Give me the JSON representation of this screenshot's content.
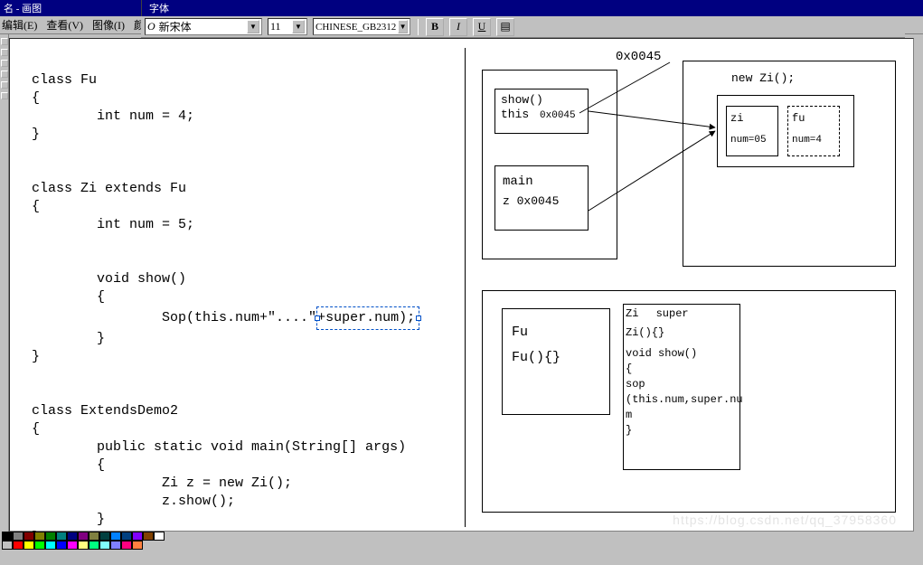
{
  "window": {
    "title_left": "名 - 画图",
    "title_sub": "字体"
  },
  "menu": {
    "edit": "编辑(E)",
    "view": "查看(V)",
    "image": "图像(I)",
    "color": "颜色("
  },
  "toolbar": {
    "font_prefix": "O",
    "font_name": "新宋体",
    "font_size": "11",
    "charset": "CHINESE_GB2312",
    "bold": "B",
    "italic": "I",
    "underline": "U"
  },
  "code": {
    "l1": "class Fu",
    "l2": "{",
    "l3": "        int num = 4;",
    "l4": "}",
    "l5": "",
    "l6": "",
    "l7": "class Zi extends Fu",
    "l8": "{",
    "l9": "        int num = 5;",
    "l10": "",
    "l11": "",
    "l12": "        void show()",
    "l13": "        {",
    "l14a": "                Sop(this.num+\"....\"",
    "sel": "+super.num);",
    "l15": "        }",
    "l16": "}",
    "l17": "",
    "l18": "",
    "l19": "class ExtendsDemo2",
    "l20": "{",
    "l21": "        public static void main(String[] args)",
    "l22": "        {",
    "l23": "                Zi z = new Zi();",
    "l24": "                z.show();",
    "l25": "        }",
    "l26": "}"
  },
  "diagram": {
    "addr": "0x0045",
    "stack_show_l1": "show()",
    "stack_show_l2": "this",
    "stack_show_addr": "0x0045",
    "stack_main_l1": "main",
    "stack_main_l2": "z 0x0045",
    "heap_new": "new Zi();",
    "heap_zi_name": "zi",
    "heap_zi_val": "num=05",
    "heap_fu_name": "fu",
    "heap_fu_val": "num=4",
    "method_fu_l1": "Fu",
    "method_fu_l2": "Fu(){}",
    "method_zi_l1": "Zi",
    "method_zi_l1b": "super",
    "method_zi_l2": "Zi(){}",
    "method_zi_l3": "void show()",
    "method_zi_l4": "{",
    "method_zi_l5": "sop",
    "method_zi_l6": "(this.num,super.nu",
    "method_zi_l6b": "m",
    "method_zi_l7": "}"
  },
  "watermark": "https://blog.csdn.net/qq_37958360",
  "palette": [
    "#000000",
    "#808080",
    "#800000",
    "#808000",
    "#008000",
    "#008080",
    "#000080",
    "#800080",
    "#808040",
    "#004040",
    "#0080ff",
    "#004080",
    "#8000ff",
    "#804000",
    "#ffffff",
    "#c0c0c0",
    "#ff0000",
    "#ffff00",
    "#00ff00",
    "#00ffff",
    "#0000ff",
    "#ff00ff",
    "#ffff80",
    "#00ff80",
    "#80ffff",
    "#8080ff",
    "#ff0080",
    "#ff8040"
  ]
}
